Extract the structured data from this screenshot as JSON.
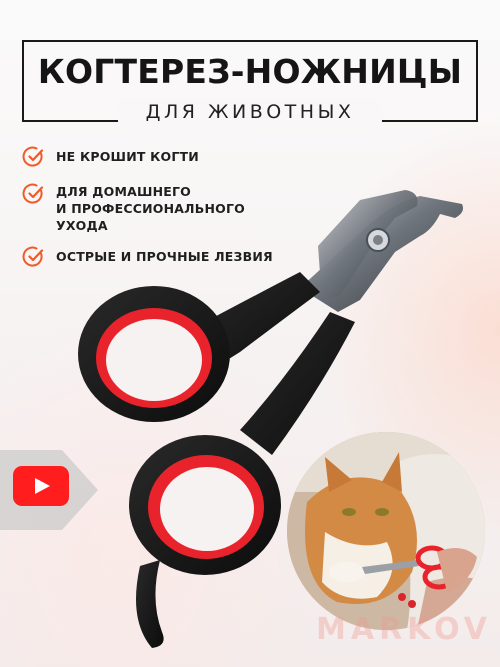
{
  "title": "КОГТЕРЕЗ-НОЖНИЦЫ",
  "subtitle": "ДЛЯ ЖИВОТНЫХ",
  "features": [
    {
      "icon": "check-circle-icon",
      "text": "НЕ КРОШИТ КОГТИ"
    },
    {
      "icon": "check-circle-icon",
      "text": "ДЛЯ ДОМАШНЕГО\nИ ПРОФЕССИОНАЛЬНОГО\nУХОДА"
    },
    {
      "icon": "check-circle-icon",
      "text": "ОСТРЫЕ И ПРОЧНЫЕ ЛЕЗВИЯ"
    }
  ],
  "video_button": {
    "icon": "play-icon"
  },
  "watermark": "MARKOV",
  "colors": {
    "accent": "#f05a28",
    "handle_black": "#161616",
    "handle_red": "#e8232c",
    "blade_steel": "#8a8f96",
    "video_red": "#ff1d1d"
  }
}
